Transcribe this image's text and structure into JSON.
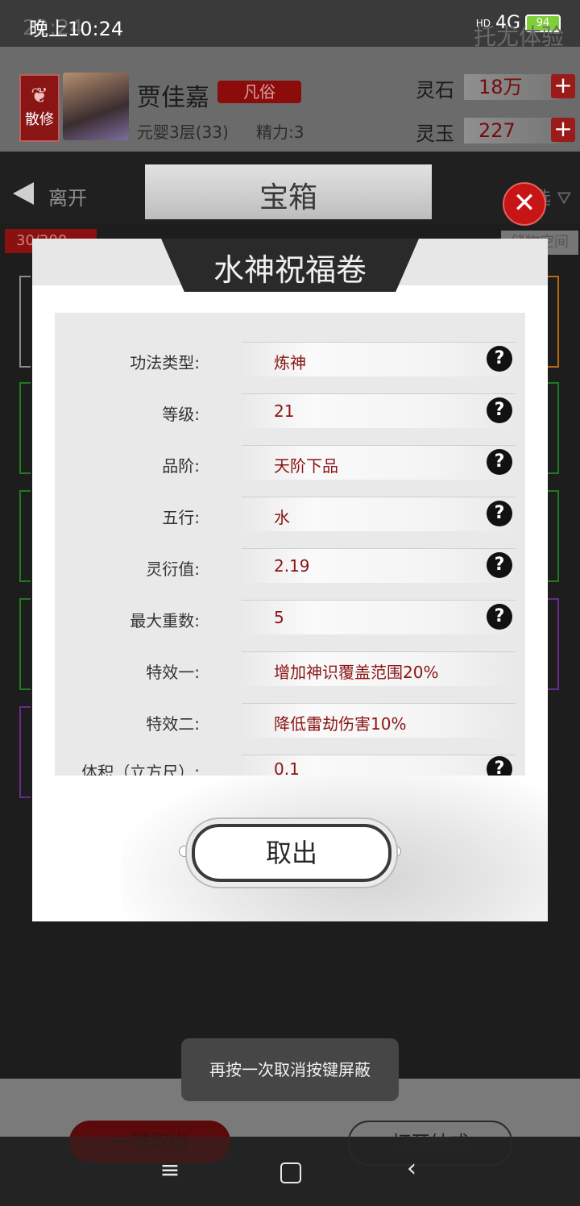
{
  "status": {
    "time": "晚上10:24",
    "network": "4G",
    "battery": "94",
    "signal": "HD"
  },
  "ghost": {
    "time": "22:24",
    "right": "托尤体验"
  },
  "player": {
    "sect": "散修",
    "name": "贾佳嘉",
    "rank": "凡俗",
    "realm": "元婴3层(33)",
    "energy": "精力:3",
    "currencies": [
      {
        "label": "灵石",
        "value": "18万"
      },
      {
        "label": "灵玉",
        "value": "227"
      }
    ]
  },
  "nav": {
    "leave": "离开",
    "title": "宝箱",
    "filter": "选",
    "counter": "30/200",
    "space": "储物空间"
  },
  "dialog": {
    "title": "水神祝福卷",
    "rows": [
      {
        "label": "功法类型:",
        "value": "炼神",
        "help": true
      },
      {
        "label": "等级:",
        "value": "21",
        "help": true
      },
      {
        "label": "品阶:",
        "value": "天阶下品",
        "help": true
      },
      {
        "label": "五行:",
        "value": "水",
        "help": true
      },
      {
        "label": "灵衍值:",
        "value": "2.19",
        "help": true
      },
      {
        "label": "最大重数:",
        "value": "5",
        "help": true
      },
      {
        "label": "特效一:",
        "value": "增加神识覆盖范围20%",
        "help": false
      },
      {
        "label": "特效二:",
        "value": "降低雷劫伤害10%",
        "help": false
      },
      {
        "label": "体积（立方尺）:",
        "value": "0.1",
        "help": true
      }
    ],
    "take_button": "取出"
  },
  "toast": "再按一次取消按键屏蔽",
  "bottom": {
    "take_all": "一键取出",
    "open_ring": "打开纳戒"
  },
  "colors": {
    "accent_red": "#8a1414",
    "close_red": "#c71414",
    "panel_gray": "#e9e9e9"
  }
}
